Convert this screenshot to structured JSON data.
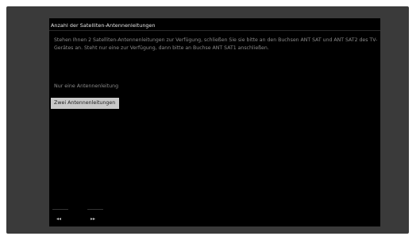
{
  "dialog": {
    "title": "Anzahl der Satelliten-Antennenleitungen",
    "description": "Stehen Ihnen 2 Satelliten-Antennenleitungen zur Verfügung, schließen Sie sie bitte an den Buchsen ANT SAT und ANT SAT2 des TV-Gerätes an. Steht nur eine zur Verfügung, dann bitte an Buchse ANT SAT1 anschließen.",
    "options": [
      {
        "label": "Nur eine Antennenleitung",
        "selected": false
      },
      {
        "label": "Zwei Antennenleitungen",
        "selected": true
      }
    ]
  },
  "footer": {
    "back_icon": "double-left-arrow",
    "back_glyph": "◂◂",
    "forward_icon": "double-right-arrow",
    "forward_glyph": "▸▸"
  },
  "colors": {
    "screen_background": "#000000",
    "bezel": "#3a3a3a",
    "title_text": "#e8e8e8",
    "body_text": "#8a8a8a",
    "selected_background": "#c9c9c9",
    "selected_text": "#1a1a1a"
  }
}
